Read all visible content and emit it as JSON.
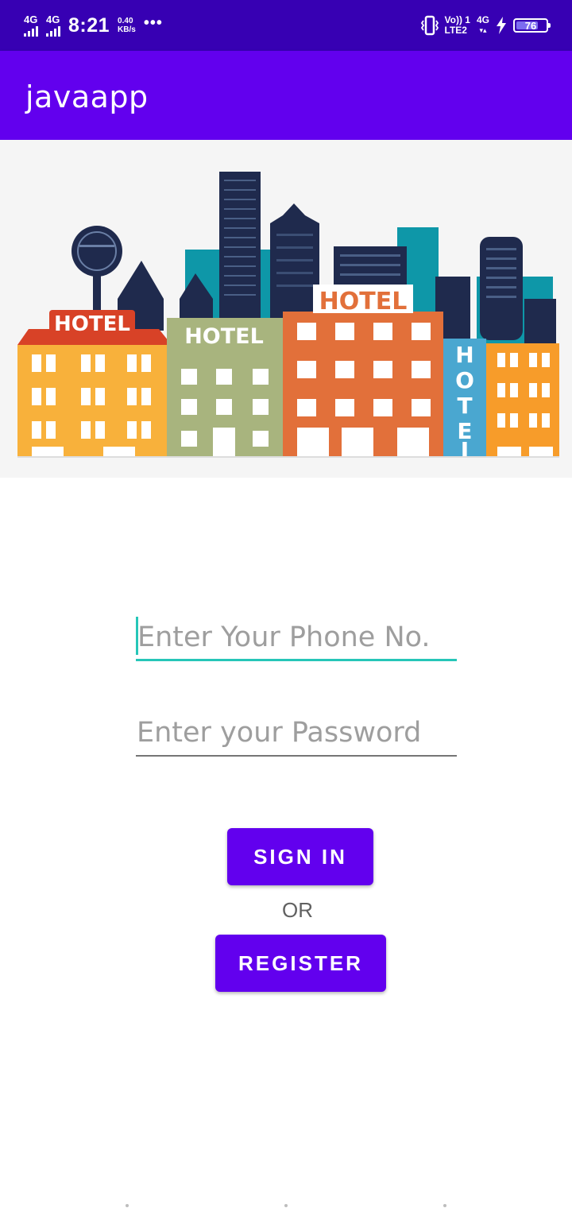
{
  "status_bar": {
    "network1": "4G",
    "network2": "4G",
    "time": "8:21",
    "speed_value": "0.40",
    "speed_unit": "KB/s",
    "more": "•••",
    "volte_top": "Vo)) 1",
    "volte_bottom": "LTE2",
    "net_right": "4G",
    "battery": "76",
    "battery_level": 0.76
  },
  "app_bar": {
    "title": "javaapp"
  },
  "banner": {
    "signs": [
      "HOTEL",
      "HOTEL",
      "HOTEL",
      "HOTEL",
      "HOTE"
    ]
  },
  "form": {
    "phone_placeholder": "Enter Your Phone No.",
    "password_placeholder": "Enter your Password",
    "signin_label": "SIGN IN",
    "or_label": "OR",
    "register_label": "REGISTER"
  },
  "colors": {
    "primary": "#6200EE",
    "primary_dark": "#3700B3",
    "accent": "#26c6b8"
  }
}
